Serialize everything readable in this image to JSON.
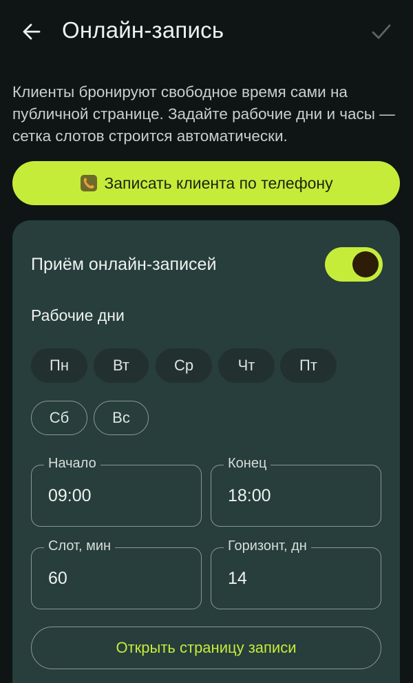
{
  "header": {
    "title": "Онлайн-запись",
    "back_icon": "arrow-left-icon",
    "confirm_icon": "check-icon"
  },
  "description": "Клиенты бронируют свободное время сами на публичной странице. Задайте рабочие дни и часы — сетка слотов строится автоматически.",
  "phone_booking": {
    "icon": "phone-icon",
    "label": "Записать клиента по телефону"
  },
  "online_booking": {
    "label": "Приём онлайн-записей",
    "enabled": true
  },
  "work_days": {
    "label": "Рабочие дни",
    "days": [
      {
        "label": "Пн",
        "selected": true
      },
      {
        "label": "Вт",
        "selected": true
      },
      {
        "label": "Ср",
        "selected": true
      },
      {
        "label": "Чт",
        "selected": true
      },
      {
        "label": "Пт",
        "selected": true
      },
      {
        "label": "Сб",
        "selected": false
      },
      {
        "label": "Вс",
        "selected": false
      }
    ]
  },
  "fields": {
    "start": {
      "label": "Начало",
      "value": "09:00"
    },
    "end": {
      "label": "Конец",
      "value": "18:00"
    },
    "slot": {
      "label": "Слот, мин",
      "value": "60"
    },
    "horizon": {
      "label": "Горизонт, дн",
      "value": "14"
    }
  },
  "open_page_label": "Открыть страницу записи",
  "colors": {
    "background": "#0f1515",
    "card": "#273e3c",
    "accent": "#c6ec3a"
  }
}
